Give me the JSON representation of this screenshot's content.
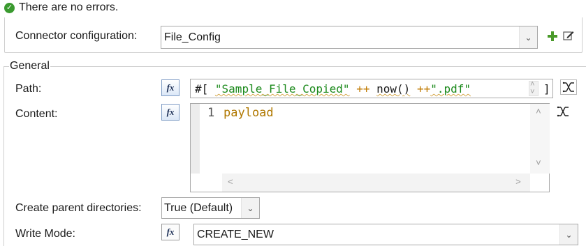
{
  "status": {
    "icon": "check-circle-icon",
    "message": "There are no errors."
  },
  "connector": {
    "label": "Connector configuration:",
    "value": "File_Config",
    "add_icon": "add-icon",
    "edit_icon": "edit-icon"
  },
  "general": {
    "legend": "General",
    "path": {
      "label": "Path:",
      "fx_label": "fx",
      "expr_open": "#[",
      "tokens": {
        "str1": "\"Sample_File_Copied\"",
        "op1": "++",
        "fn": "now",
        "paren_open": "(",
        "paren_close": ")",
        "op2": "++",
        "str2": "\".pdf\""
      },
      "expr_close": "]"
    },
    "content": {
      "label": "Content:",
      "fx_label": "fx",
      "line_number": "1",
      "code": "payload"
    },
    "create_parent": {
      "label": "Create parent directories:",
      "value": "True (Default)"
    },
    "write_mode": {
      "label": "Write Mode:",
      "fx_label": "fx",
      "value": "CREATE_NEW"
    }
  },
  "colors": {
    "string": "#1c8a1c",
    "operator": "#c07a00",
    "keyword": "#b07800",
    "success": "#3a9a2f"
  }
}
